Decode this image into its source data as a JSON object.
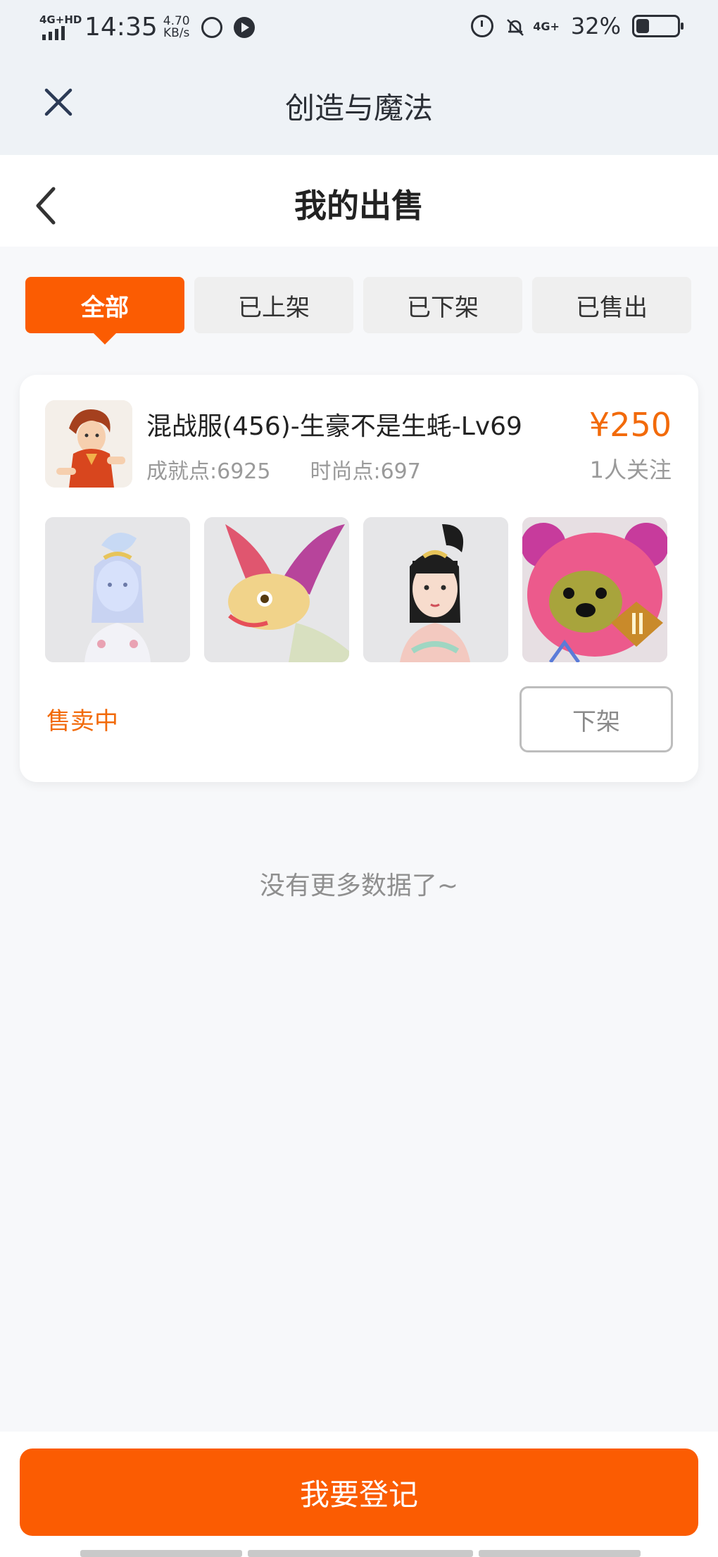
{
  "status_bar": {
    "network": "4G+HD",
    "time": "14:35",
    "speed_value": "4.70",
    "speed_unit": "KB/s",
    "network_right": "4G+",
    "battery_percent_text": "32%",
    "battery_level": 0.32,
    "icons": [
      "signal-icon",
      "data-saver-icon",
      "play-icon",
      "alarm-icon",
      "mute-icon",
      "battery-icon"
    ]
  },
  "app_bar": {
    "title": "创造与魔法",
    "close_icon": "close-icon"
  },
  "header": {
    "title": "我的出售",
    "back_icon": "back-arrow-icon"
  },
  "tabs": [
    {
      "label": "全部",
      "active": true
    },
    {
      "label": "已上架",
      "active": false
    },
    {
      "label": "已下架",
      "active": false
    },
    {
      "label": "已售出",
      "active": false
    }
  ],
  "listing": {
    "title": "混战服(456)-生豪不是生蚝-Lv69",
    "achievement": "成就点:6925",
    "fashion": "时尚点:697",
    "price": "¥250",
    "followers": "1人关注",
    "status": "售卖中",
    "delist_label": "下架",
    "thumbnails": [
      "costume-avatar",
      "dragon-mount",
      "character-portrait",
      "pink-bear-pet"
    ]
  },
  "empty_hint": "没有更多数据了~",
  "footer": {
    "register_label": "我要登记"
  },
  "colors": {
    "accent": "#fb5c02",
    "price": "#f26a0a",
    "background": "#f7f8fa"
  }
}
